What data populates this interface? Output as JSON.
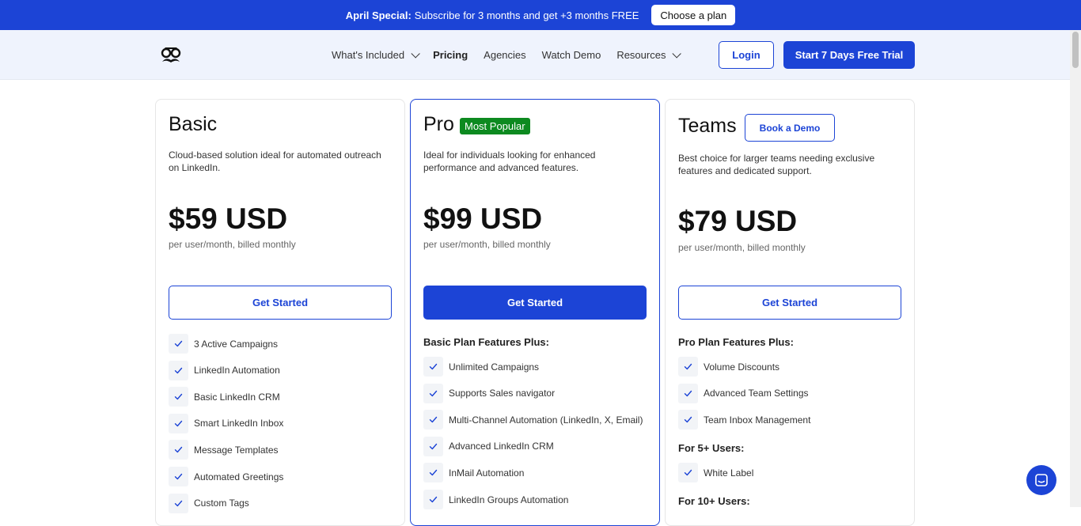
{
  "promo": {
    "bold": "April Special:",
    "text": "Subscribe for 3 months and get +3 months FREE",
    "button": "Choose a plan"
  },
  "nav": {
    "items": [
      "What's Included",
      "Pricing",
      "Agencies",
      "Watch Demo",
      "Resources"
    ],
    "login": "Login",
    "trial": "Start 7 Days Free Trial"
  },
  "plans": {
    "basic": {
      "name": "Basic",
      "desc": "Cloud-based solution ideal for automated outreach on LinkedIn.",
      "price": "$59 USD",
      "billing": "per user/month, billed monthly",
      "cta": "Get Started",
      "features": [
        "3 Active Campaigns",
        "LinkedIn Automation",
        "Basic LinkedIn CRM",
        "Smart LinkedIn Inbox",
        "Message Templates",
        "Automated Greetings",
        "Custom Tags"
      ]
    },
    "pro": {
      "name": "Pro",
      "badge": "Most Popular",
      "desc": "Ideal for individuals looking for enhanced performance and advanced features.",
      "price": "$99 USD",
      "billing": "per user/month, billed monthly",
      "cta": "Get Started",
      "subhead": "Basic Plan Features Plus:",
      "features": [
        "Unlimited Campaigns",
        "Supports Sales navigator",
        "Multi-Channel Automation (LinkedIn, X, Email)",
        "Advanced LinkedIn CRM",
        "InMail Automation",
        "LinkedIn Groups Automation"
      ]
    },
    "teams": {
      "name": "Teams",
      "demo": "Book a Demo",
      "desc": "Best choice for larger teams needing exclusive features and dedicated support.",
      "price": "$79 USD",
      "billing": "per user/month, billed monthly",
      "cta": "Get Started",
      "subhead": "Pro Plan Features Plus:",
      "features": [
        "Volume Discounts",
        "Advanced Team Settings",
        "Team Inbox Management"
      ],
      "subhead2": "For 5+ Users:",
      "features2": [
        "White Label"
      ],
      "subhead3": "For 10+ Users:"
    }
  },
  "colors": {
    "brand": "#1c44d6",
    "badge": "#0d8a20"
  },
  "icons": [
    "logo-glasses-icon",
    "chevron-down-icon",
    "check-icon",
    "chat-icon"
  ]
}
